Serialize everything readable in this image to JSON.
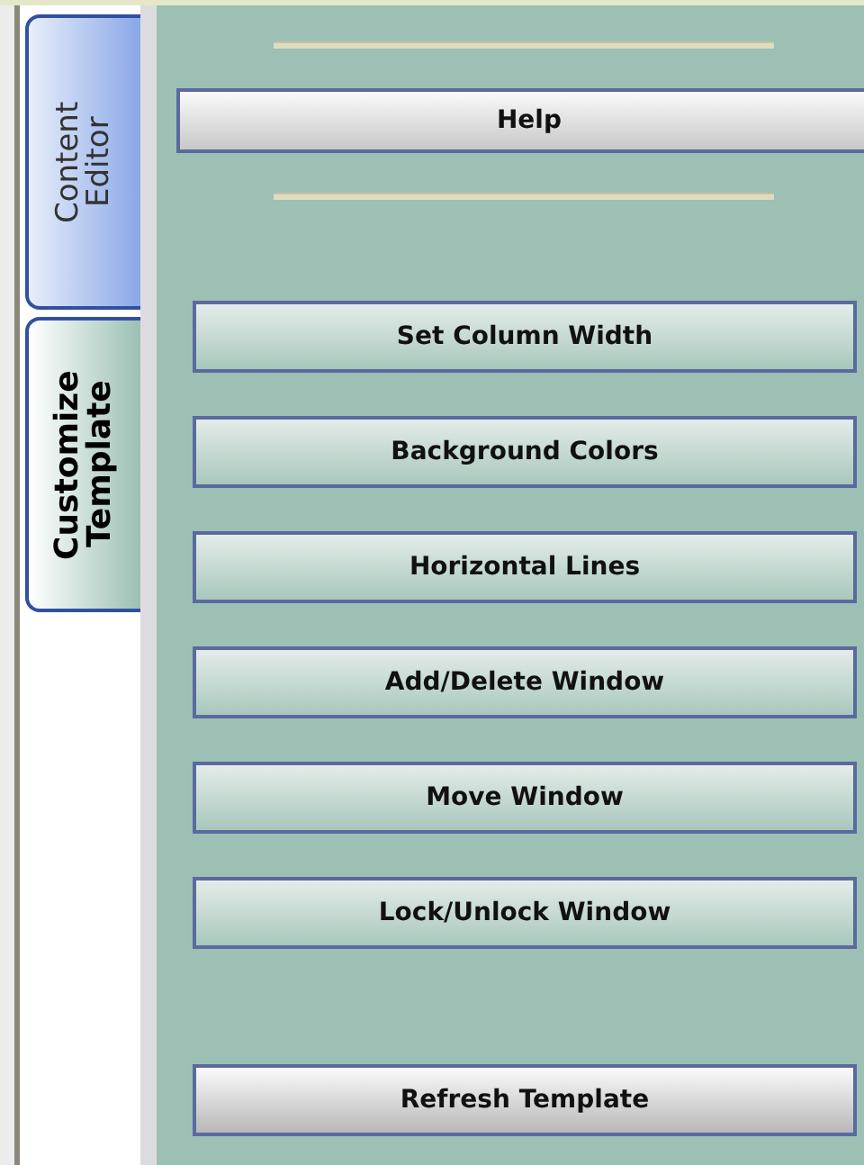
{
  "tabs": [
    {
      "label": "Content Editor",
      "selected": false
    },
    {
      "label": "Customize Template",
      "selected": true
    }
  ],
  "help_button": {
    "label": "Help"
  },
  "buttons": [
    {
      "label": "Set Column Width",
      "kind": "action"
    },
    {
      "label": "Background Colors",
      "kind": "action"
    },
    {
      "label": "Horizontal Lines",
      "kind": "action"
    },
    {
      "label": "Add/Delete Window",
      "kind": "action"
    },
    {
      "label": "Move Window",
      "kind": "action"
    },
    {
      "label": "Lock/Unlock Window",
      "kind": "action"
    },
    {
      "label": "Refresh Template",
      "kind": "refresh"
    }
  ]
}
